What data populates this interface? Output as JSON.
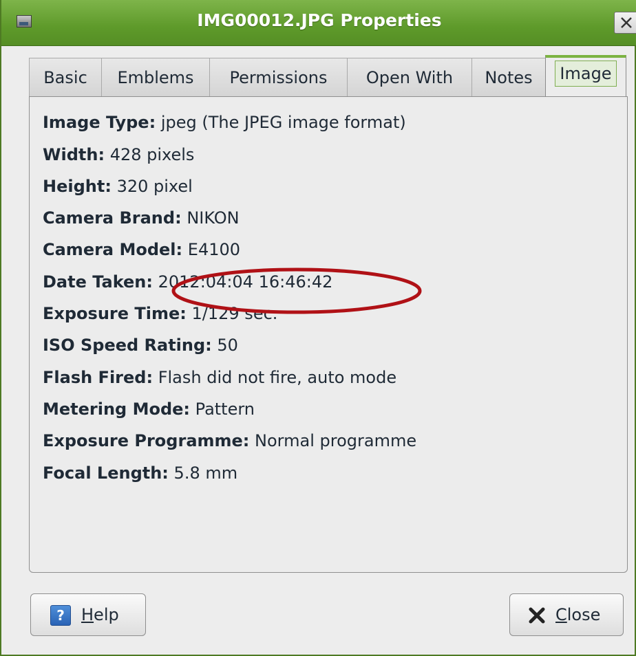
{
  "window": {
    "title": "IMG00012.JPG Properties",
    "app_icon": "image-file-icon",
    "close_icon": "close-icon"
  },
  "tabs": [
    {
      "label": "Basic",
      "active": false
    },
    {
      "label": "Emblems",
      "active": false
    },
    {
      "label": "Permissions",
      "active": false
    },
    {
      "label": "Open With",
      "active": false
    },
    {
      "label": "Notes",
      "active": false
    },
    {
      "label": "Image",
      "active": true
    }
  ],
  "properties": [
    {
      "key": "Image Type:",
      "value": "jpeg (The JPEG image format)"
    },
    {
      "key": "Width:",
      "value": "428 pixels"
    },
    {
      "key": "Height:",
      "value": "320 pixel"
    },
    {
      "key": "Camera Brand:",
      "value": "NIKON"
    },
    {
      "key": "Camera Model:",
      "value": "E4100"
    },
    {
      "key": "Date Taken:",
      "value": "2012:04:04 16:46:42"
    },
    {
      "key": "Exposure Time:",
      "value": "1/129 sec."
    },
    {
      "key": "ISO Speed Rating:",
      "value": "50"
    },
    {
      "key": "Flash Fired:",
      "value": "Flash did not fire, auto mode"
    },
    {
      "key": "Metering Mode:",
      "value": "Pattern"
    },
    {
      "key": "Exposure Programme:",
      "value": "Normal programme"
    },
    {
      "key": "Focal Length:",
      "value": "5.8 mm"
    }
  ],
  "annotation": {
    "shape": "ellipse",
    "color": "#b01116",
    "target": "Date Taken value"
  },
  "buttons": {
    "help": {
      "mnemonic": "H",
      "rest": "elp",
      "icon": "help-icon"
    },
    "close": {
      "mnemonic": "C",
      "rest": "lose",
      "icon": "close-x-icon"
    }
  },
  "colors": {
    "titlebar": "#6aa436",
    "tab_accent": "#7cb342",
    "annotation": "#b01116"
  }
}
